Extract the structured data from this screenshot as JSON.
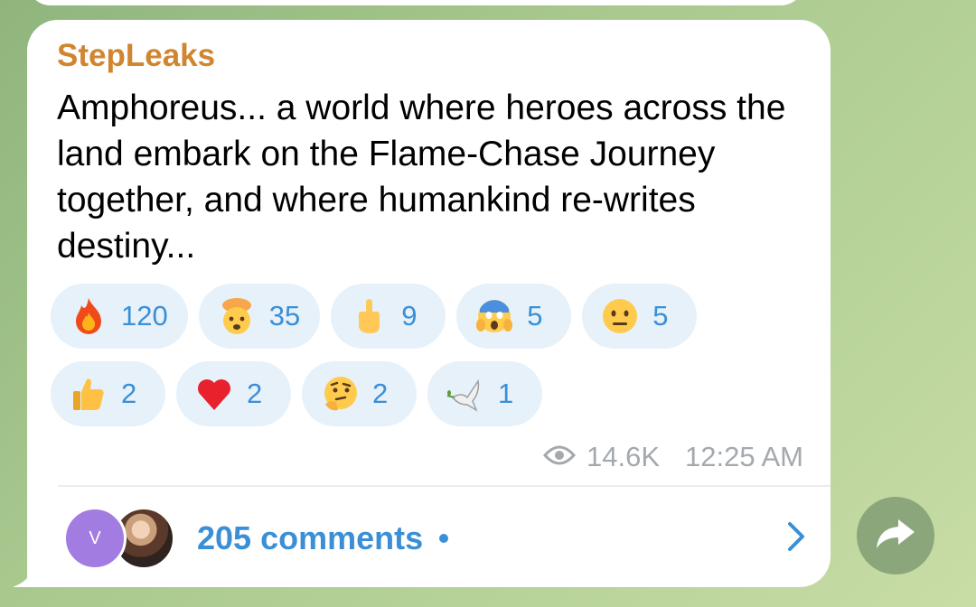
{
  "post": {
    "channel_name": "StepLeaks",
    "message": "Amphoreus... a world where heroes across the land embark on the Flame-Chase Journey together, and where humankind re-writes destiny...",
    "views": "14.6K",
    "time": "12:25 AM"
  },
  "reactions": [
    {
      "emoji": "fire-emoji",
      "count": "120"
    },
    {
      "emoji": "exploding-head-emoji",
      "count": "35"
    },
    {
      "emoji": "middle-finger-emoji",
      "count": "9"
    },
    {
      "emoji": "scream-emoji",
      "count": "5"
    },
    {
      "emoji": "neutral-face-emoji",
      "count": "5"
    },
    {
      "emoji": "thumbs-up-emoji",
      "count": "2"
    },
    {
      "emoji": "red-heart-emoji",
      "count": "2"
    },
    {
      "emoji": "thinking-face-emoji",
      "count": "2"
    },
    {
      "emoji": "dove-emoji",
      "count": "1"
    }
  ],
  "comments": {
    "avatar_letter": "V",
    "label": "205 comments"
  },
  "colors": {
    "channel": "#d2852f",
    "accent": "#3a8fd6",
    "reaction_bg": "#e6f1fa",
    "avatar_v": "#a27ce0"
  }
}
